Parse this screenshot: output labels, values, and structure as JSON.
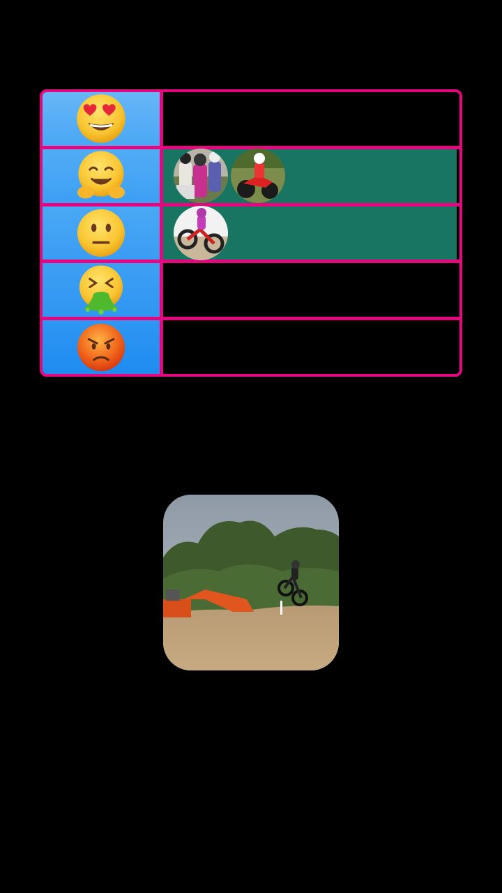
{
  "tiers": [
    {
      "icon": "heart-eyes-emoji-icon",
      "items": []
    },
    {
      "icon": "hugging-face-emoji-icon",
      "items": [
        "riders-group-thumbnail",
        "red-motocross-rider-thumbnail"
      ]
    },
    {
      "icon": "neutral-face-emoji-icon",
      "items": [
        "wheelie-rider-thumbnail"
      ]
    },
    {
      "icon": "vomiting-face-emoji-icon",
      "items": []
    },
    {
      "icon": "angry-face-emoji-icon",
      "items": []
    }
  ],
  "colors": {
    "border": "#e5077f",
    "label_blue": "#3c9ff4",
    "filled_row": "#177561",
    "background": "#000000"
  },
  "current_item": {
    "icon": "motocross-jump-photo"
  }
}
